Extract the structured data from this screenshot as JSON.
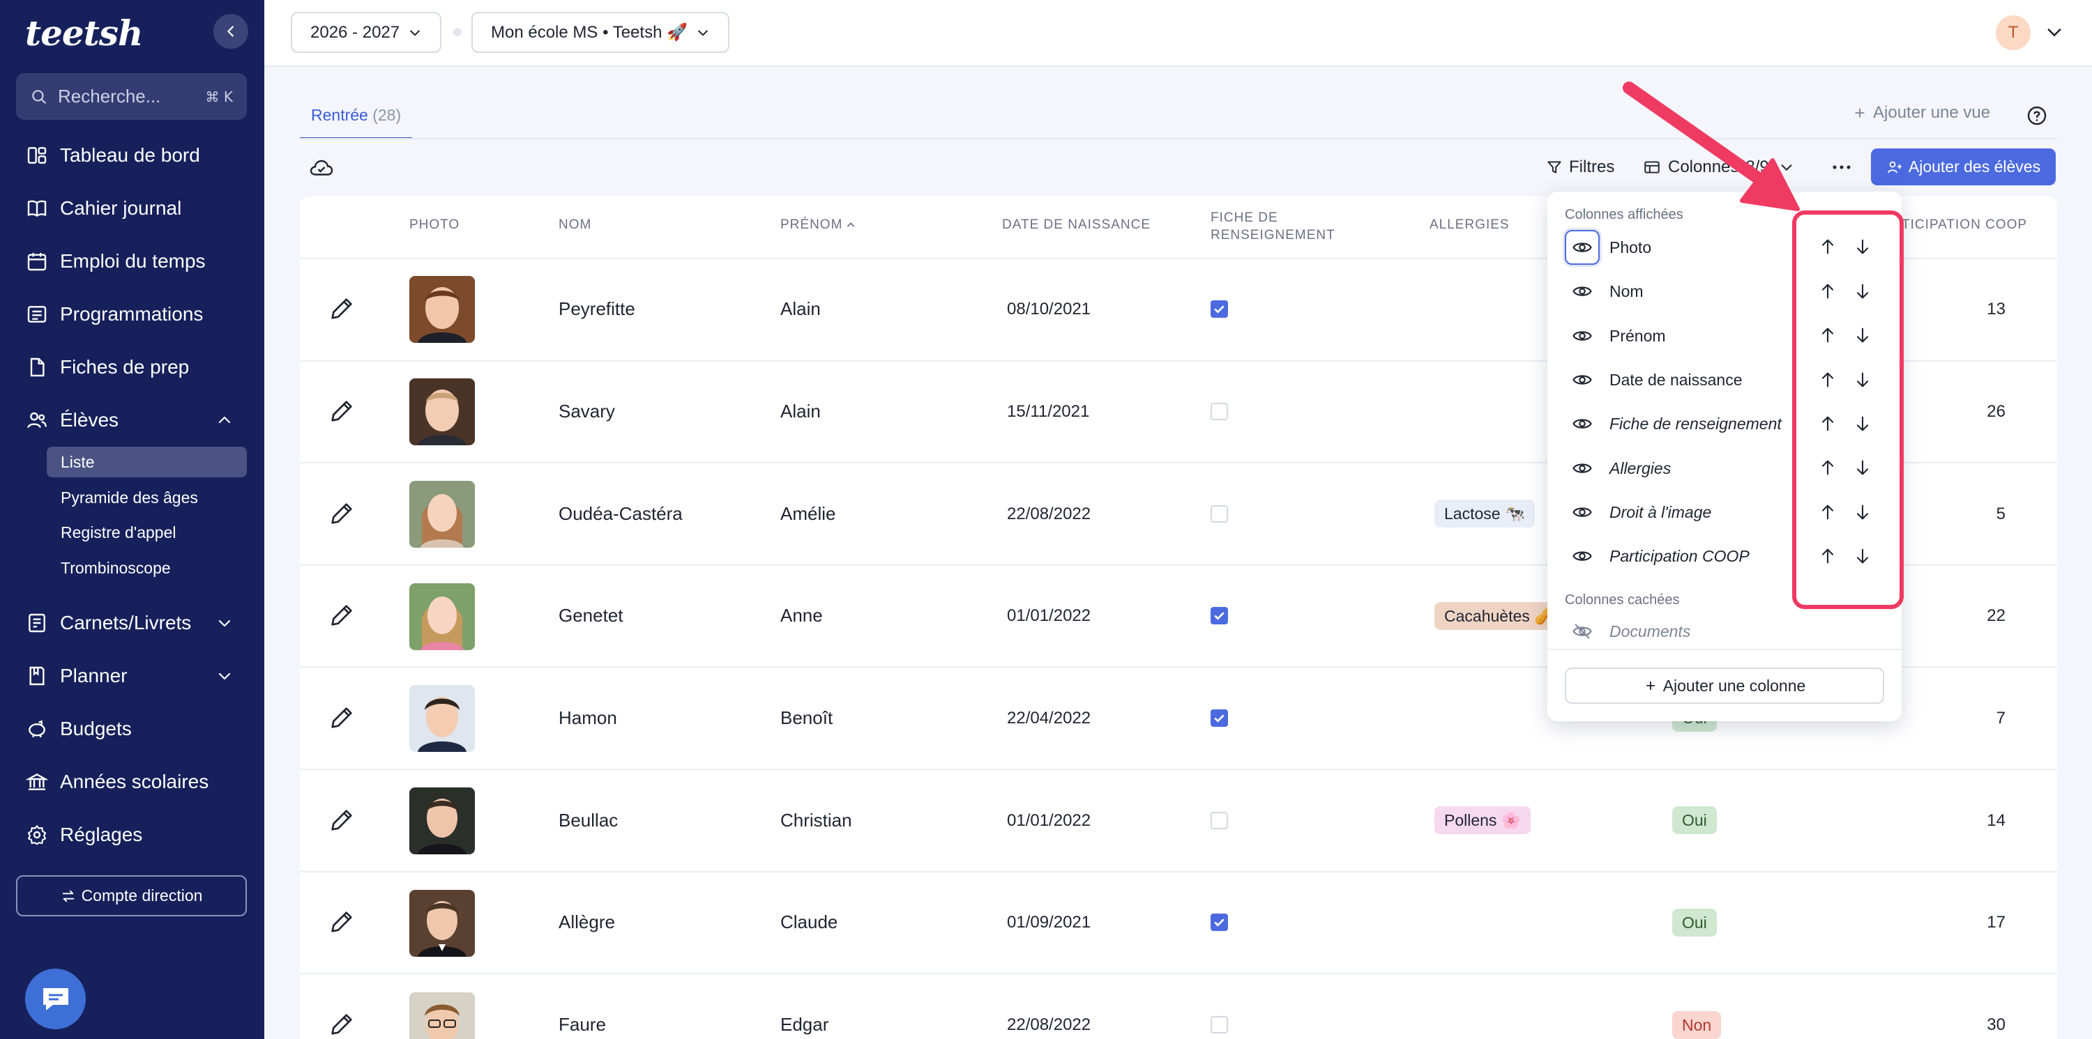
{
  "app": {
    "logo": "teetsh"
  },
  "sidebar": {
    "search": {
      "placeholder": "Recherche...",
      "shortcut": "⌘ K"
    },
    "items": [
      {
        "label": "Tableau de bord",
        "icon": "dashboard-icon"
      },
      {
        "label": "Cahier journal",
        "icon": "book-icon"
      },
      {
        "label": "Emploi du temps",
        "icon": "calendar-icon"
      },
      {
        "label": "Programmations",
        "icon": "list-icon"
      },
      {
        "label": "Fiches de prep",
        "icon": "file-icon"
      },
      {
        "label": "Élèves",
        "icon": "users-icon",
        "expanded": true
      },
      {
        "label": "Carnets/Livrets",
        "icon": "notebook-icon"
      },
      {
        "label": "Planner",
        "icon": "planner-icon"
      },
      {
        "label": "Budgets",
        "icon": "piggy-bank-icon"
      },
      {
        "label": "Années scolaires",
        "icon": "bank-icon"
      },
      {
        "label": "Réglages",
        "icon": "gear-icon"
      }
    ],
    "sub_items": [
      {
        "label": "Liste",
        "active": true
      },
      {
        "label": "Pyramide des âges"
      },
      {
        "label": "Registre d'appel"
      },
      {
        "label": "Trombinoscope"
      }
    ],
    "account_button": "Compte direction"
  },
  "topbar": {
    "year": "2026 - 2027",
    "school": "Mon école MS • Teetsh 🚀",
    "avatar_initial": "T"
  },
  "tabs": [
    {
      "label": "Rentrée",
      "count": "(28)"
    }
  ],
  "actions": {
    "add_view": "Ajouter une vue",
    "filters": "Filtres",
    "columns": "Colonnes",
    "columns_count": "8/9",
    "add_students": "Ajouter des élèves"
  },
  "table": {
    "headers": {
      "photo": "PHOTO",
      "nom": "NOM",
      "prenom": "PRÉNOM",
      "date": "DATE DE NAISSANCE",
      "fiche_line1": "FICHE DE",
      "fiche_line2": "RENSEIGNEMENT",
      "allergies": "ALLERGIES",
      "coop": "TICIPATION COOP"
    },
    "rows": [
      {
        "nom": "Peyrefitte",
        "prenom": "Alain",
        "date": "08/10/2021",
        "fiche": true,
        "allergie": "",
        "droit": "",
        "coop": "13"
      },
      {
        "nom": "Savary",
        "prenom": "Alain",
        "date": "15/11/2021",
        "fiche": false,
        "allergie": "",
        "droit": "",
        "coop": "26"
      },
      {
        "nom": "Oudéa-Castéra",
        "prenom": "Amélie",
        "date": "22/08/2022",
        "fiche": false,
        "allergie": "Lactose 🐄",
        "droit": "",
        "coop": "5"
      },
      {
        "nom": "Genetet",
        "prenom": "Anne",
        "date": "01/01/2022",
        "fiche": true,
        "allergie": "Cacahuètes 🥜",
        "droit": "",
        "coop": "22"
      },
      {
        "nom": "Hamon",
        "prenom": "Benoît",
        "date": "22/04/2022",
        "fiche": true,
        "allergie": "",
        "droit": "Oui",
        "coop": "7"
      },
      {
        "nom": "Beullac",
        "prenom": "Christian",
        "date": "01/01/2022",
        "fiche": false,
        "allergie": "Pollens 🌸",
        "droit": "Oui",
        "coop": "14"
      },
      {
        "nom": "Allègre",
        "prenom": "Claude",
        "date": "01/09/2021",
        "fiche": true,
        "allergie": "",
        "droit": "Oui",
        "coop": "17"
      },
      {
        "nom": "Faure",
        "prenom": "Edgar",
        "date": "22/08/2022",
        "fiche": false,
        "allergie": "",
        "droit": "Non",
        "coop": "30"
      }
    ]
  },
  "columns_panel": {
    "visible_title": "Colonnes affichées",
    "visible": [
      {
        "label": "Photo",
        "italic": false
      },
      {
        "label": "Nom",
        "italic": false
      },
      {
        "label": "Prénom",
        "italic": false
      },
      {
        "label": "Date de naissance",
        "italic": false
      },
      {
        "label": "Fiche de renseignement",
        "italic": true
      },
      {
        "label": "Allergies",
        "italic": true
      },
      {
        "label": "Droit à l'image",
        "italic": true
      },
      {
        "label": "Participation COOP",
        "italic": true
      }
    ],
    "hidden_title": "Colonnes cachées",
    "hidden": [
      {
        "label": "Documents"
      }
    ],
    "add_column": "Ajouter une colonne"
  },
  "colors": {
    "sidebar_bg": "#16205b",
    "accent": "#4c6ae0",
    "highlight": "#ef3a61",
    "tag_lactose_bg": "#e9edf7",
    "tag_cacahuetes_bg": "#efd4c4",
    "tag_pollens_bg": "#f6d8ef",
    "badge_oui_bg": "#cfe8cf",
    "badge_non_bg": "#fbd5d0"
  }
}
